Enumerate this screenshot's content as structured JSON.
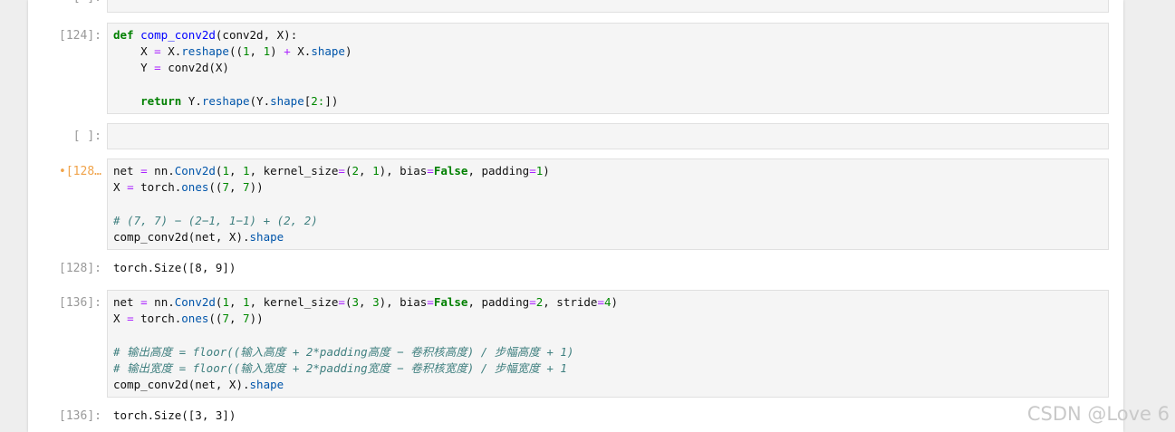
{
  "cells": [
    {
      "prompt": "[ ]:"
    },
    {
      "prompt": "[124]:"
    },
    {
      "prompt": "[ ]:"
    },
    {
      "prompt": "[128…"
    },
    {
      "prompt": "[136]:"
    }
  ],
  "outputs": [
    {
      "prompt": "[128]:",
      "text": "torch.Size([8, 9])"
    },
    {
      "prompt": "[136]:",
      "text": "torch.Size([3, 3])"
    }
  ],
  "code": {
    "cell124": {
      "l1_def": "def",
      "l1_name": "comp_conv2d",
      "l1_args": "(conv2d, X):",
      "l2_a": "    X ",
      "l2_eq": "=",
      "l2_b": " X.",
      "l2_reshape": "reshape",
      "l2_c": "((",
      "l2_n1": "1",
      "l2_d": ", ",
      "l2_n2": "1",
      "l2_e": ") ",
      "l2_plus": "+",
      "l2_f": " X.",
      "l2_shape": "shape",
      "l2_g": ")",
      "l3_a": "    Y ",
      "l3_eq": "=",
      "l3_b": " conv2d(X)",
      "l5_indent": "    ",
      "l5_return": "return",
      "l5_a": " Y.",
      "l5_reshape": "reshape",
      "l5_b": "(Y.",
      "l5_shape": "shape",
      "l5_c": "[",
      "l5_n": "2:",
      "l5_d": "])"
    },
    "cell128": {
      "l1_a": "net ",
      "l1_eq": "=",
      "l1_b": " nn.",
      "l1_cls": "Conv2d",
      "l1_c": "(",
      "l1_n1": "1",
      "l1_d": ", ",
      "l1_n2": "1",
      "l1_e": ", kernel_size",
      "l1_eq2": "=",
      "l1_f": "(",
      "l1_n3": "2",
      "l1_g": ", ",
      "l1_n4": "1",
      "l1_h": "), bias",
      "l1_eq3": "=",
      "l1_false": "False",
      "l1_i": ", padding",
      "l1_eq4": "=",
      "l1_n5": "1",
      "l1_j": ")",
      "l2_a": "X ",
      "l2_eq": "=",
      "l2_b": " torch.",
      "l2_ones": "ones",
      "l2_c": "((",
      "l2_n1": "7",
      "l2_d": ", ",
      "l2_n2": "7",
      "l2_e": "))",
      "l4_comment": "# (7, 7) − (2−1, 1−1) + (2, 2)",
      "l5_a": "comp_conv2d(net, X).",
      "l5_shape": "shape"
    },
    "cell136": {
      "l1_a": "net ",
      "l1_eq": "=",
      "l1_b": " nn.",
      "l1_cls": "Conv2d",
      "l1_c": "(",
      "l1_n1": "1",
      "l1_d": ", ",
      "l1_n2": "1",
      "l1_e": ", kernel_size",
      "l1_eq2": "=",
      "l1_f": "(",
      "l1_n3": "3",
      "l1_g": ", ",
      "l1_n4": "3",
      "l1_h": "), bias",
      "l1_eq3": "=",
      "l1_false": "False",
      "l1_i": ", padding",
      "l1_eq4": "=",
      "l1_n5": "2",
      "l1_j": ", stride",
      "l1_eq5": "=",
      "l1_n6": "4",
      "l1_k": ")",
      "l2_a": "X ",
      "l2_eq": "=",
      "l2_b": " torch.",
      "l2_ones": "ones",
      "l2_c": "((",
      "l2_n1": "7",
      "l2_d": ", ",
      "l2_n2": "7",
      "l2_e": "))",
      "l4_comment": "# 输出高度 = floor((输入高度 + 2*padding高度 − 卷积核高度) / 步幅高度 + 1)",
      "l5_comment": "# 输出宽度 = floor((输入宽度 + 2*padding宽度 − 卷积核宽度) / 步幅宽度 + 1",
      "l6_a": "comp_conv2d(net, X).",
      "l6_shape": "shape"
    }
  },
  "watermark": "CSDN @Love 6"
}
